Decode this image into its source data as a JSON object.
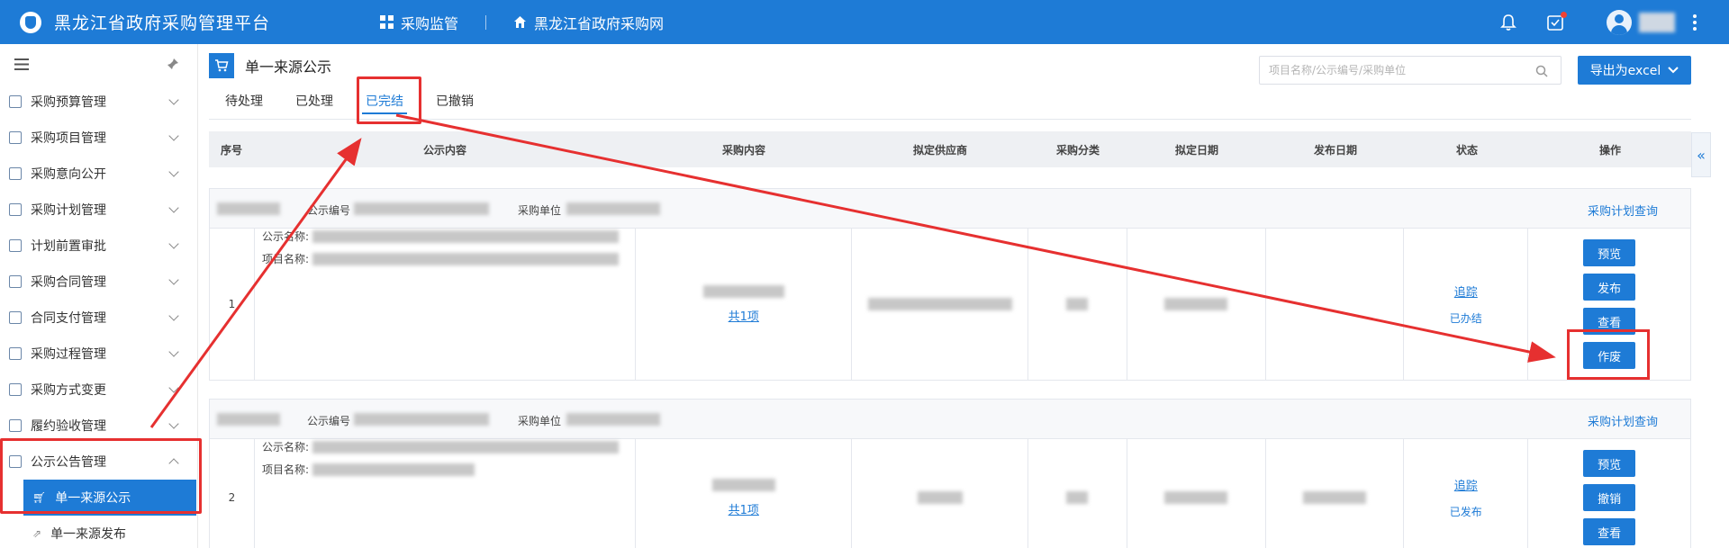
{
  "header": {
    "app_title": "黑龙江省政府采购管理平台",
    "nav": [
      {
        "label": "采购监管",
        "icon": "grid-icon"
      },
      {
        "label": "黑龙江省政府采购网",
        "icon": "home-icon"
      }
    ],
    "icons": [
      "bell-icon",
      "task-icon",
      "avatar",
      "more-icon"
    ]
  },
  "sidebar": {
    "items": [
      {
        "label": "采购预算管理",
        "icon": "budget-icon"
      },
      {
        "label": "采购项目管理",
        "icon": "project-icon"
      },
      {
        "label": "采购意向公开",
        "icon": "intent-icon"
      },
      {
        "label": "采购计划管理",
        "icon": "plan-icon"
      },
      {
        "label": "计划前置审批",
        "icon": "approval-icon"
      },
      {
        "label": "采购合同管理",
        "icon": "contract-icon"
      },
      {
        "label": "合同支付管理",
        "icon": "payment-icon"
      },
      {
        "label": "采购过程管理",
        "icon": "process-icon"
      },
      {
        "label": "采购方式变更",
        "icon": "method-icon"
      },
      {
        "label": "履约验收管理",
        "icon": "acceptance-icon"
      },
      {
        "label": "公示公告管理",
        "icon": "notice-icon",
        "expanded": true
      }
    ],
    "subitems": [
      {
        "label": "单一来源公示",
        "active": true
      },
      {
        "label": "单一来源发布",
        "active": false
      }
    ]
  },
  "page": {
    "title": "单一来源公示",
    "search_placeholder": "项目名称/公示编号/采购单位",
    "export_label": "导出为excel",
    "tabs": [
      "待处理",
      "已处理",
      "已完结",
      "已撤销"
    ],
    "active_tab": "已完结"
  },
  "table": {
    "columns": [
      "序号",
      "公示内容",
      "采购内容",
      "拟定供应商",
      "采购分类",
      "拟定日期",
      "发布日期",
      "状态",
      "操作"
    ],
    "record_head": {
      "code_label": "公示编号",
      "unit_label": "采购单位",
      "link_label": "采购计划查询"
    },
    "name_labels": {
      "notice": "公示名称:",
      "project": "项目名称:"
    },
    "rows": [
      {
        "index": "1",
        "content_link": "共1项",
        "track": "追踪",
        "status": "已办结",
        "actions": [
          "预览",
          "发布",
          "查看",
          "作废"
        ]
      },
      {
        "index": "2",
        "content_link": "共1项",
        "track": "追踪",
        "status": "已发布",
        "actions": [
          "预览",
          "撤销",
          "查看"
        ]
      }
    ]
  },
  "colors": {
    "primary": "#1e7bd6",
    "annotation": "#e63030"
  }
}
